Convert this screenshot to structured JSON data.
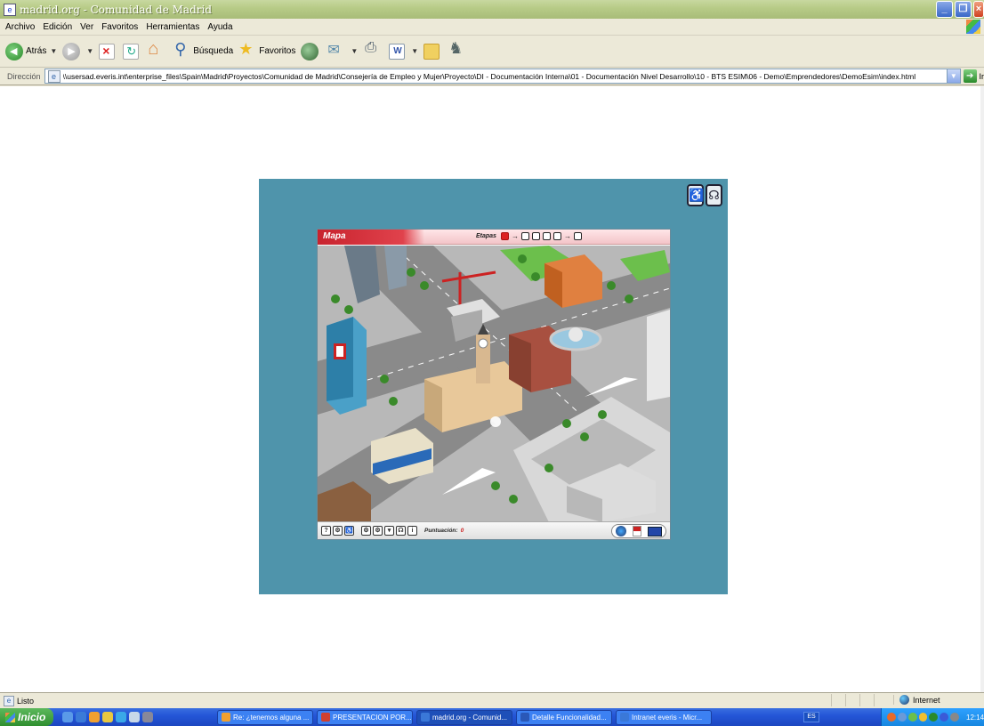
{
  "window": {
    "title": "madrid.org - Comunidad de Madrid"
  },
  "menu": [
    "Archivo",
    "Edición",
    "Ver",
    "Favoritos",
    "Herramientas",
    "Ayuda"
  ],
  "toolbar": {
    "back_label": "Atrás",
    "search_label": "Búsqueda",
    "favorites_label": "Favoritos"
  },
  "address": {
    "label": "Dirección",
    "url": "\\\\usersad.everis.int\\enterprise_files\\Spain\\Madrid\\Proyectos\\Comunidad de Madrid\\Consejería de Empleo y Mujer\\Proyecto\\DI - Documentación Interna\\01 - Documentación Nivel Desarrollo\\10 - BTS ESIM\\06 - Demo\\Emprendedores\\DemoEsim\\index.html",
    "go_label": "Ir"
  },
  "game": {
    "map_title": "Mapa",
    "stages_label": "Etapas",
    "stages_total": 6,
    "stages_done": 1,
    "score_label": "Puntuación:",
    "score_value": "0",
    "footer_buttons_left": [
      "?",
      "⚙",
      "♿"
    ],
    "footer_buttons_right": [
      "⚙",
      "⚙",
      "▾",
      "☊",
      "i"
    ]
  },
  "status": {
    "text": "Listo",
    "zone": "Internet"
  },
  "taskbar": {
    "start_label": "Inicio",
    "tasks": [
      {
        "label": "Re: ¿tenemos alguna ...",
        "active": false,
        "icon_color": "#f0a030"
      },
      {
        "label": "PRESENTACION POR...",
        "active": false,
        "icon_color": "#d04030"
      },
      {
        "label": "madrid.org - Comunid...",
        "active": true,
        "icon_color": "#3a78d8"
      },
      {
        "label": "Detalle Funcionalidad...",
        "active": false,
        "icon_color": "#2a58b8"
      },
      {
        "label": "Intranet everis - Micr...",
        "active": false,
        "icon_color": "#3a78d8"
      }
    ],
    "lang": "ES",
    "clock": "12:14"
  }
}
